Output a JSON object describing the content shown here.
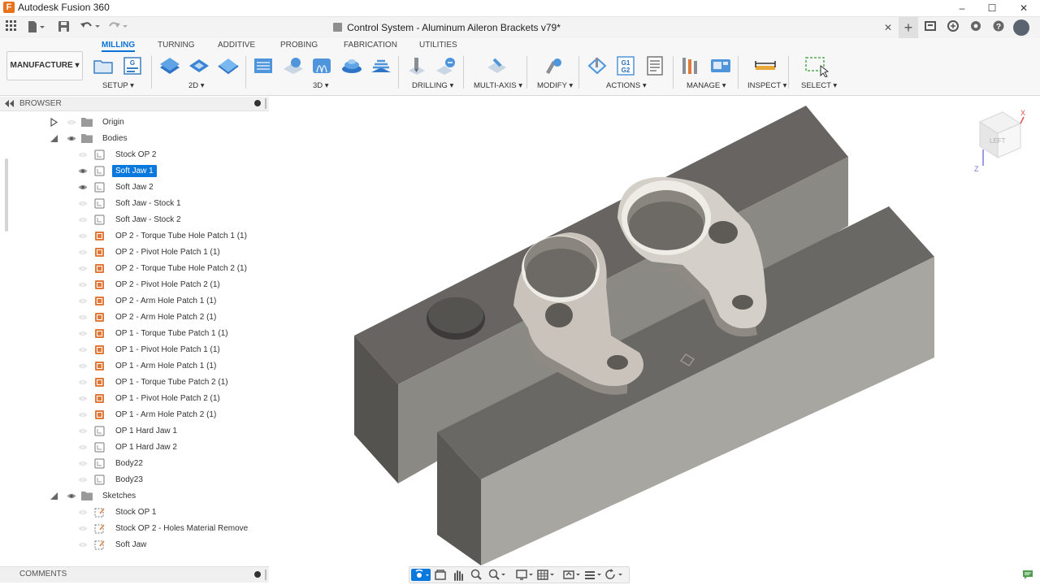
{
  "app": {
    "title": "Autodesk Fusion 360",
    "icon_letter": "F"
  },
  "window_controls": {
    "minimize": "–",
    "maximize": "☐",
    "close": "✕"
  },
  "document": {
    "title": "Control System - Aluminum Aileron Brackets v79*",
    "close": "✕",
    "new_tab": "+"
  },
  "workspace": {
    "label": "MANUFACTURE ▾"
  },
  "tabs": [
    "MILLING",
    "TURNING",
    "ADDITIVE",
    "PROBING",
    "FABRICATION",
    "UTILITIES"
  ],
  "groups": [
    {
      "label": "SETUP ▾"
    },
    {
      "label": "2D ▾"
    },
    {
      "label": "3D ▾"
    },
    {
      "label": "DRILLING ▾"
    },
    {
      "label": "MULTI-AXIS ▾"
    },
    {
      "label": "MODIFY ▾"
    },
    {
      "label": "ACTIONS ▾"
    },
    {
      "label": "MANAGE ▾"
    },
    {
      "label": "INSPECT ▾"
    },
    {
      "label": "SELECT ▾"
    }
  ],
  "browser": {
    "title": "BROWSER",
    "items": [
      {
        "label": "Origin"
      },
      {
        "label": "Bodies"
      },
      {
        "label": "Stock OP 2"
      },
      {
        "label": "Soft Jaw 1"
      },
      {
        "label": "Soft Jaw 2"
      },
      {
        "label": "Soft Jaw - Stock 1"
      },
      {
        "label": "Soft Jaw - Stock 2"
      },
      {
        "label": "OP 2 - Torque Tube Hole Patch 1 (1)"
      },
      {
        "label": "OP 2 - Pivot Hole Patch 1 (1)"
      },
      {
        "label": "OP 2 - Torque Tube Hole Patch 2 (1)"
      },
      {
        "label": "OP 2 - Pivot Hole Patch 2 (1)"
      },
      {
        "label": "OP 2 - Arm Hole Patch 1 (1)"
      },
      {
        "label": "OP 2 - Arm Hole Patch 2 (1)"
      },
      {
        "label": "OP 1 - Torque Tube Patch 1 (1)"
      },
      {
        "label": "OP 1 - Pivot Hole Patch 1 (1)"
      },
      {
        "label": "OP 1 - Arm Hole Patch 1 (1)"
      },
      {
        "label": "OP 1 - Torque Tube Patch 2 (1)"
      },
      {
        "label": "OP 1 - Pivot Hole Patch 2 (1)"
      },
      {
        "label": "OP 1 - Arm Hole Patch 2 (1)"
      },
      {
        "label": "OP 1 Hard Jaw 1"
      },
      {
        "label": "OP 1 Hard Jaw 2"
      },
      {
        "label": "Body22"
      },
      {
        "label": "Body23"
      },
      {
        "label": "Sketches"
      },
      {
        "label": "Stock OP 1"
      },
      {
        "label": "Stock OP 2 - Holes Material Remove"
      },
      {
        "label": "Soft Jaw"
      }
    ]
  },
  "comments": {
    "title": "COMMENTS"
  },
  "viewcube": {
    "face_label": "LEFT",
    "axis_x": "X",
    "axis_z": "Z"
  },
  "colors": {
    "accent": "#0a79dd",
    "brand": "#e8731b",
    "patch": "#e07a3a"
  }
}
